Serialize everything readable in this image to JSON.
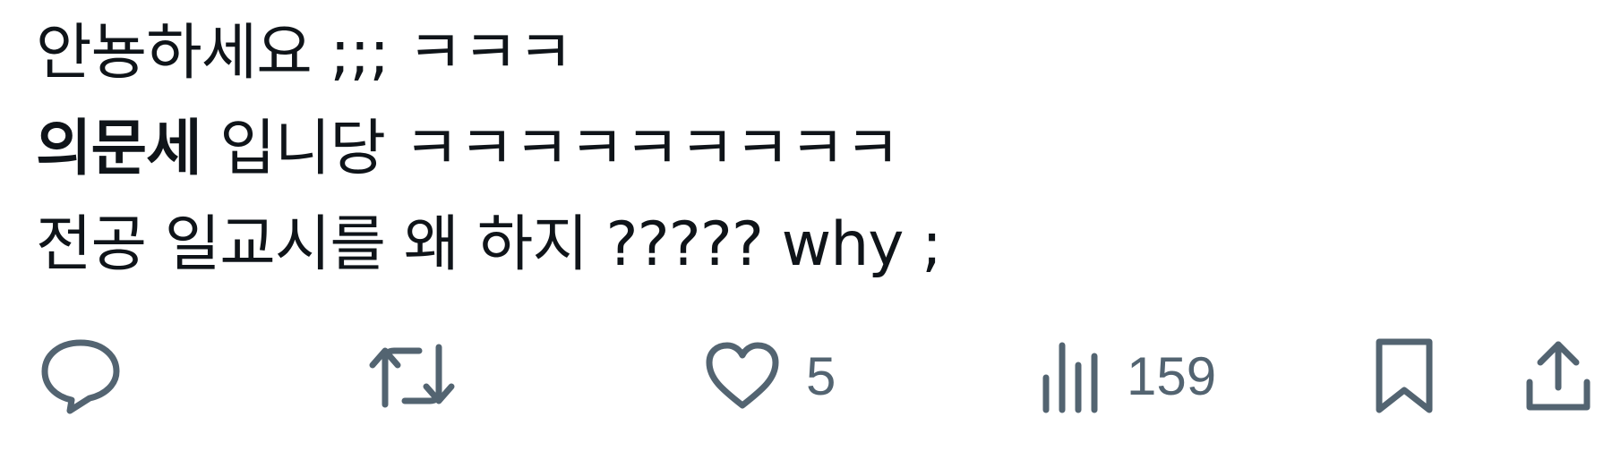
{
  "tweet": {
    "line1": "안뇽하세요 ;;; ㅋㅋㅋ",
    "line2_bold": "의문세",
    "line2_rest": " 입니당 ㅋㅋㅋㅋㅋㅋㅋㅋㅋ",
    "line3": "전공 일교시를 왜 하지 ????? why ;"
  },
  "actions": {
    "reply": {
      "icon": "reply-icon"
    },
    "retweet": {
      "icon": "retweet-icon"
    },
    "like": {
      "icon": "heart-icon",
      "count": "5"
    },
    "views": {
      "icon": "views-icon",
      "count": "159"
    },
    "bookmark": {
      "icon": "bookmark-icon"
    },
    "share": {
      "icon": "share-icon"
    }
  },
  "colors": {
    "text": "#0f1419",
    "action": "#536471",
    "background": "#ffffff"
  }
}
